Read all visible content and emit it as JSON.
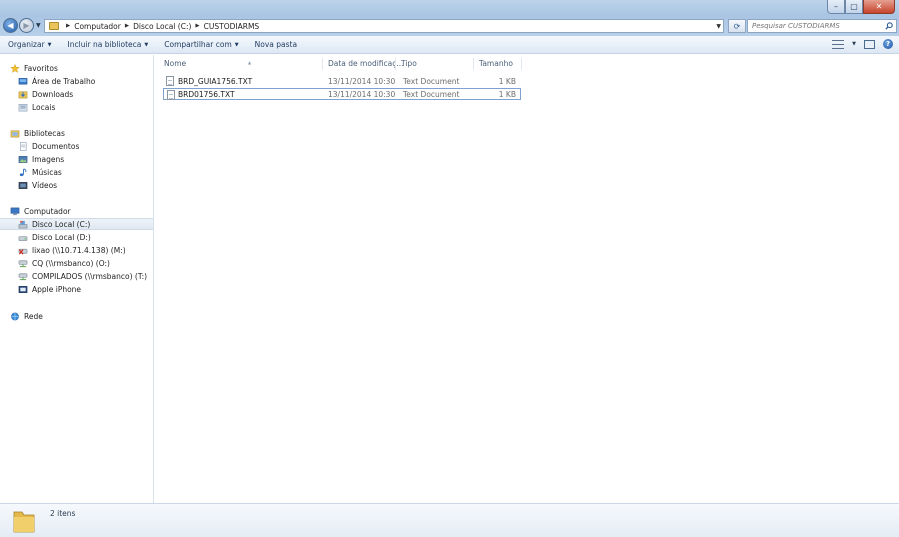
{
  "window": {
    "minimize_glyph": "–",
    "maximize_glyph": "▢",
    "close_glyph": "✕"
  },
  "nav": {
    "back_glyph": "◀",
    "forward_glyph": "▶"
  },
  "address": {
    "crumbs": [
      "Computador",
      "Disco Local (C:)",
      "CUSTODIARMS"
    ]
  },
  "search": {
    "placeholder": "Pesquisar CUSTODIARMS"
  },
  "toolbar": {
    "organize": "Organizar",
    "include_library": "Incluir na biblioteca",
    "share_with": "Compartilhar com",
    "new_folder": "Nova pasta",
    "help_glyph": "?"
  },
  "sidebar": {
    "favorites": {
      "label": "Favoritos",
      "items": [
        "Área de Trabalho",
        "Downloads",
        "Locais"
      ]
    },
    "libraries": {
      "label": "Bibliotecas",
      "items": [
        "Documentos",
        "Imagens",
        "Músicas",
        "Vídeos"
      ]
    },
    "computer": {
      "label": "Computador",
      "items": [
        "Disco Local (C:)",
        "Disco Local (D:)",
        "lixao (\\\\10.71.4.138) (M:)",
        "CQ (\\\\rmsbanco) (O:)",
        "COMPILADOS (\\\\rmsbanco) (T:)",
        "Apple iPhone"
      ]
    },
    "network": {
      "label": "Rede"
    }
  },
  "columns": {
    "name": "Nome",
    "date": "Data de modificaç...",
    "type": "Tipo",
    "size": "Tamanho"
  },
  "files": [
    {
      "name": "BRD_GUIA1756.TXT",
      "date": "13/11/2014 10:30",
      "type": "Text Document",
      "size": "1 KB"
    },
    {
      "name": "BRD01756.TXT",
      "date": "13/11/2014 10:30",
      "type": "Text Document",
      "size": "1 KB"
    }
  ],
  "status": {
    "item_count": "2 itens"
  },
  "colors": {
    "accent": "#1f5ba6",
    "titlebar": "#bcd3ea",
    "close": "#c7432c"
  }
}
